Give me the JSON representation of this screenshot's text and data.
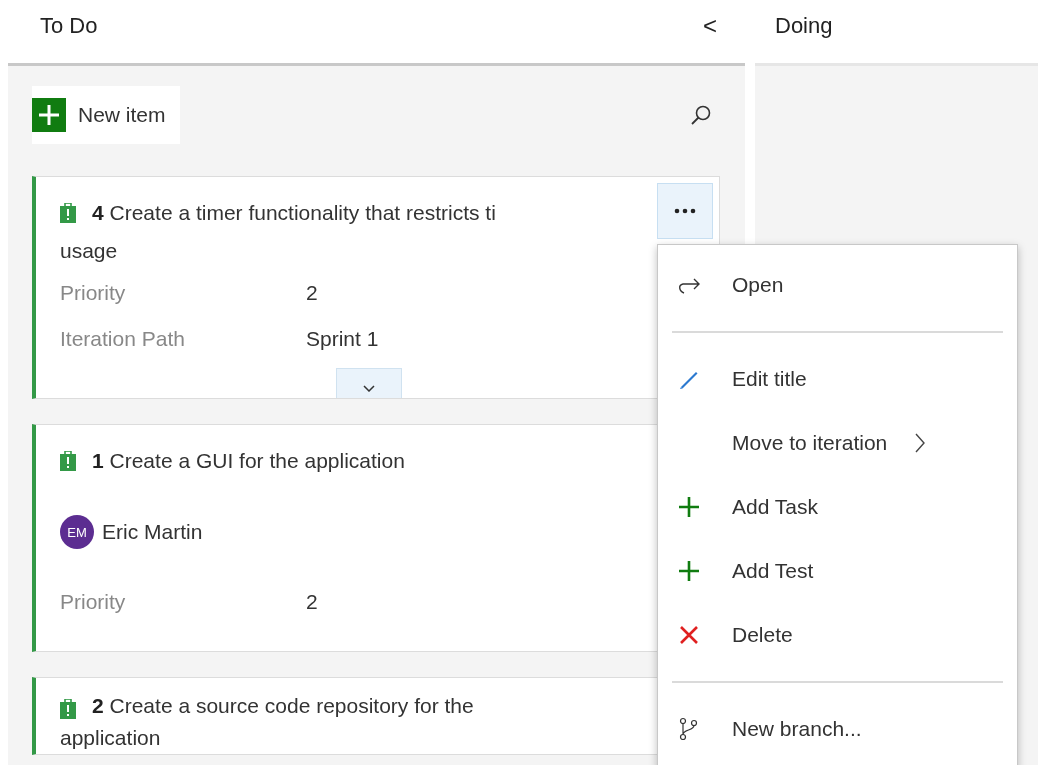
{
  "columns": [
    {
      "title": "To Do",
      "collapse_icon": "<"
    },
    {
      "title": "Doing"
    }
  ],
  "new_item": {
    "label": "New item"
  },
  "cards": [
    {
      "id": "4",
      "title_lines": [
        "Create a timer functionality that restricts ti",
        "usage"
      ],
      "fields": [
        {
          "label": "Priority",
          "value": "2"
        },
        {
          "label": "Iteration Path",
          "value": "Sprint 1"
        }
      ],
      "expandable": true,
      "menu_open": true
    },
    {
      "id": "1",
      "title_lines": [
        "Create a GUI for the application"
      ],
      "assignee": {
        "initials": "EM",
        "name": "Eric Martin",
        "color": "#5c2d91"
      },
      "fields": [
        {
          "label": "Priority",
          "value": "2"
        }
      ],
      "expandable": false,
      "menu_open": false
    },
    {
      "id": "2",
      "title_lines": [
        "Create a source code repository for the",
        "application"
      ],
      "expandable": false,
      "menu_open": false
    }
  ],
  "context_menu": [
    {
      "kind": "open",
      "label": "Open"
    },
    {
      "kind": "separator"
    },
    {
      "kind": "edit",
      "label": "Edit title"
    },
    {
      "kind": "plain",
      "label": "Move to iteration",
      "submenu": true
    },
    {
      "kind": "add",
      "label": "Add Task"
    },
    {
      "kind": "add",
      "label": "Add Test"
    },
    {
      "kind": "delete",
      "label": "Delete"
    },
    {
      "kind": "separator"
    },
    {
      "kind": "branch",
      "label": "New branch..."
    }
  ]
}
